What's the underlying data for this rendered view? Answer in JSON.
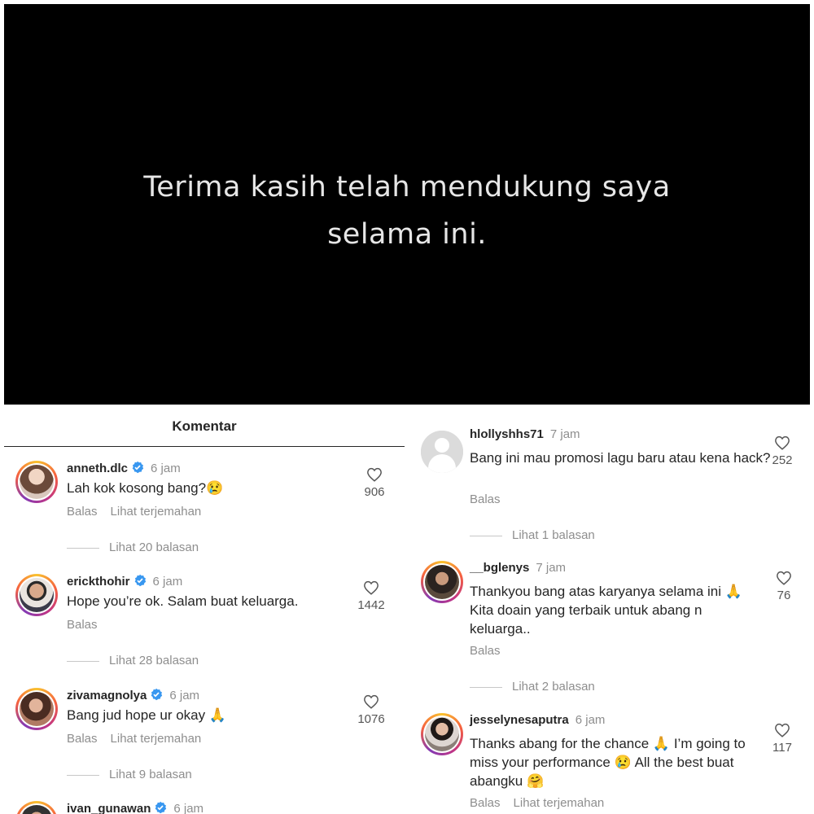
{
  "video": {
    "line1": "Terima kasih telah mendukung saya",
    "line2": "selama ini."
  },
  "left_panel": {
    "title": "Komentar",
    "comments": [
      {
        "username": "anneth.dlc",
        "verified": true,
        "time": "6 jam",
        "text": "Lah kok kosong bang?😢",
        "likes": "906",
        "reply": "Balas",
        "translate": "Lihat terjemahan",
        "replies": "Lihat 20 balasan"
      },
      {
        "username": "erickthohir",
        "verified": true,
        "time": "6 jam",
        "text": "Hope you’re ok. Salam buat keluarga.",
        "likes": "1442",
        "reply": "Balas",
        "replies": "Lihat 28 balasan"
      },
      {
        "username": "zivamagnolya",
        "verified": true,
        "time": "6 jam",
        "text": "Bang jud hope ur okay 🙏",
        "likes": "1076",
        "reply": "Balas",
        "translate": "Lihat terjemahan",
        "replies": "Lihat 9 balasan"
      },
      {
        "username": "ivan_gunawan",
        "verified": true,
        "time": "6 jam"
      }
    ]
  },
  "right_panel": {
    "comments": [
      {
        "username": "hlollyshhs71",
        "time": "7 jam",
        "text": "Bang ini mau promosi lagu baru atau kena hack?",
        "likes": "252",
        "reply": "Balas",
        "replies": "Lihat 1 balasan"
      },
      {
        "username": "__bglenys",
        "time": "7 jam",
        "text": "Thankyou bang atas karyanya selama ini 🙏 Kita doain yang terbaik untuk abang n keluarga..",
        "likes": "76",
        "reply": "Balas",
        "replies": "Lihat 2 balasan"
      },
      {
        "username": "jesselynesaputra",
        "time": "6 jam",
        "text": "Thanks abang for the chance 🙏 I’m going to miss your performance 😢 All the best buat abangku 🤗",
        "likes": "117",
        "reply": "Balas",
        "translate": "Lihat terjemahan"
      }
    ]
  },
  "colors": {
    "verified": "#3897f0",
    "muted": "#8e8e8e",
    "text": "#262626",
    "video_bg": "#000000"
  },
  "icons": [
    "heart-outline-icon",
    "verified-badge-icon",
    "default-avatar-icon"
  ]
}
